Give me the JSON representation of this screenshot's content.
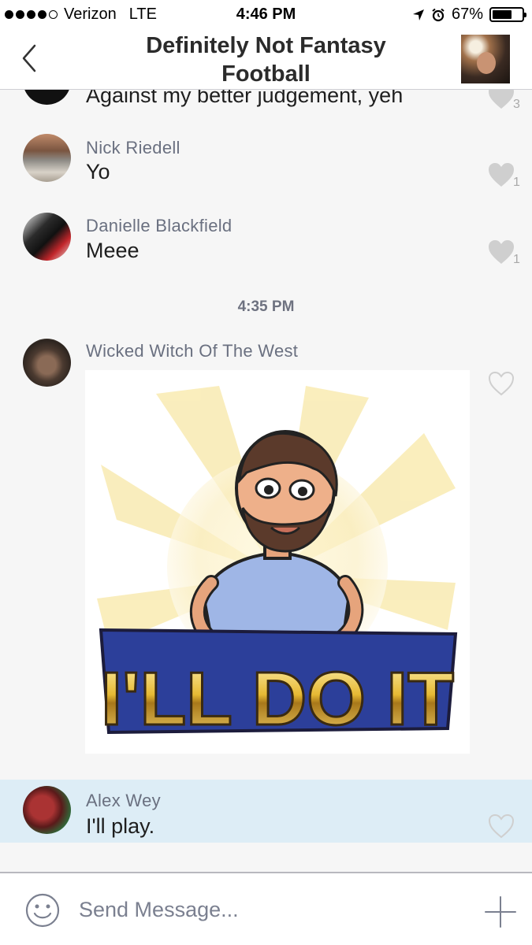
{
  "status_bar": {
    "carrier": "Verizon",
    "network": "LTE",
    "time": "4:46 PM",
    "battery": "67%",
    "battery_level": 0.67,
    "signal_bars_filled": 4,
    "signal_bars_total": 5
  },
  "header": {
    "title": "Definitely Not Fantasy Football",
    "back_icon": "chevron-left-icon"
  },
  "messages": [
    {
      "sender": "",
      "text": "Against my better judgement, yeh",
      "likes": "3",
      "liked": true
    },
    {
      "sender": "Nick Riedell",
      "text": "Yo",
      "likes": "1",
      "liked": true
    },
    {
      "sender": "Danielle Blackfield",
      "text": "Meee",
      "likes": "1",
      "liked": true
    },
    {
      "sender": "Wicked Witch Of The West",
      "image": "bitmoji-ill-do-it",
      "image_text": "I'LL DO IT",
      "liked": false
    },
    {
      "sender": "Alex Wey",
      "text": "I'll play.",
      "liked": false,
      "highlighted": true
    }
  ],
  "timestamp": "4:35 PM",
  "composer": {
    "placeholder": "Send Message...",
    "emoji_icon": "smiley-icon",
    "add_icon": "plus-icon"
  },
  "colors": {
    "background": "#f6f6f6",
    "highlight": "#ddedf6",
    "sender_text": "#6a7080",
    "like_icon": "#c8c8c8"
  }
}
